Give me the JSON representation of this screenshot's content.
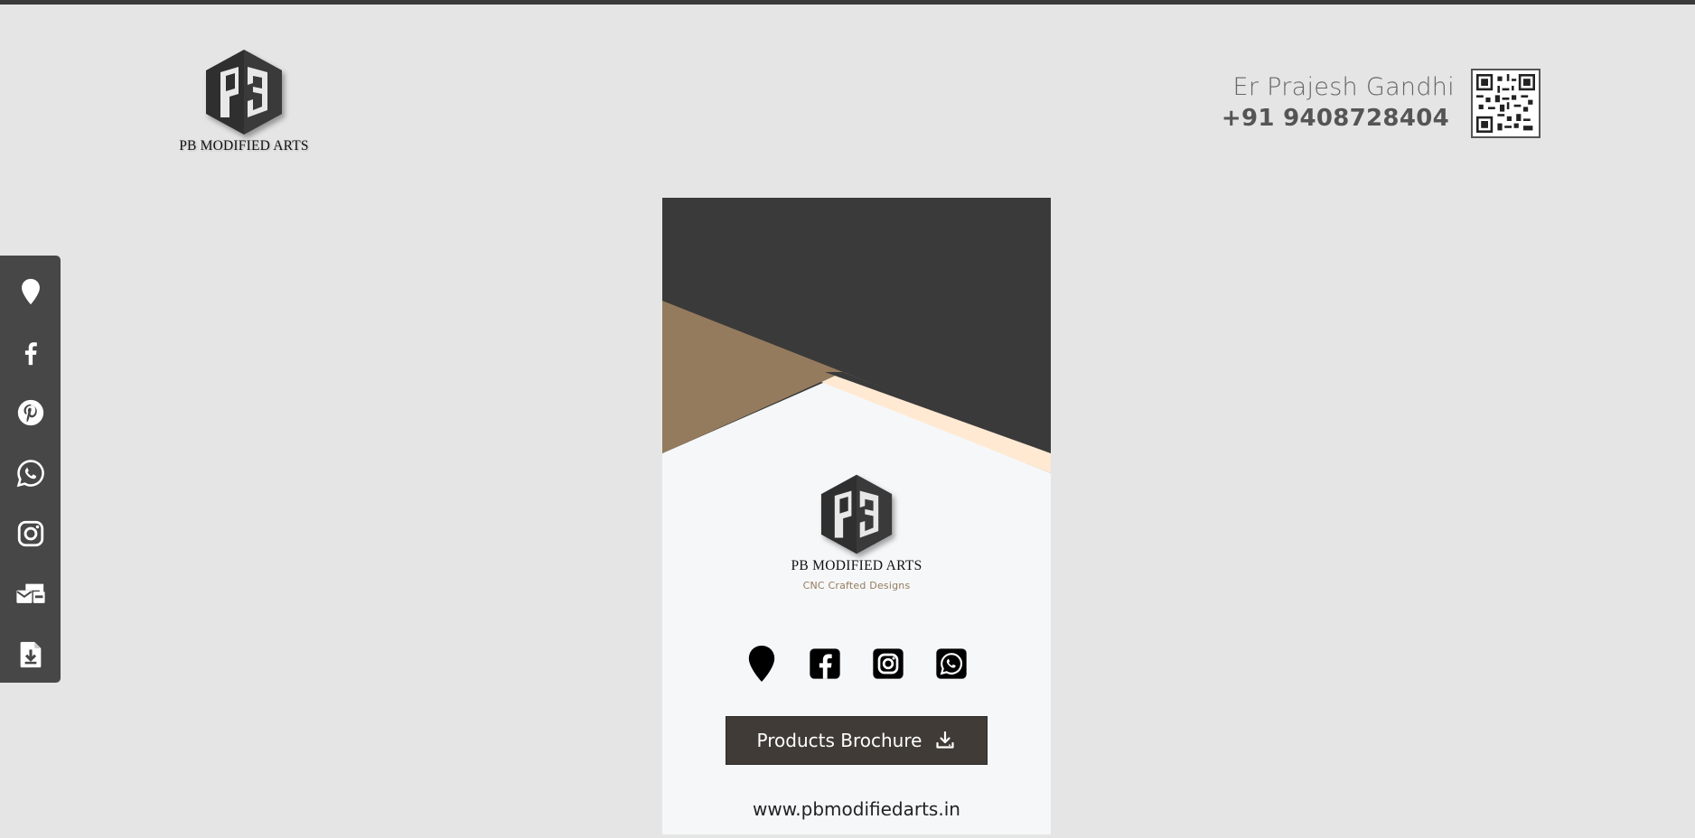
{
  "header": {
    "company_name": "PB MODIFIED ARTS",
    "contact_name": "Er Prajesh Gandhi",
    "contact_phone": "+91 9408728404"
  },
  "sidebar": {
    "items": [
      {
        "icon": "location-pin-icon"
      },
      {
        "icon": "facebook-icon"
      },
      {
        "icon": "pinterest-icon"
      },
      {
        "icon": "whatsapp-icon"
      },
      {
        "icon": "instagram-icon"
      },
      {
        "icon": "contact-cards-icon"
      },
      {
        "icon": "file-download-icon"
      }
    ]
  },
  "card": {
    "company_name": "PB MODIFIED ARTS",
    "tagline": "CNC Crafted Designs",
    "icons": [
      "location-pin-icon",
      "facebook-icon",
      "instagram-icon",
      "whatsapp-icon"
    ],
    "brochure_button": "Products Brochure",
    "website": "www.pbmodifiedarts.in"
  },
  "colors": {
    "page_bg": "#e5e5e5",
    "dark": "#3a3a3a",
    "brown": "#957b5e",
    "peach": "#ffe9d2",
    "button_bg": "#403b36"
  }
}
